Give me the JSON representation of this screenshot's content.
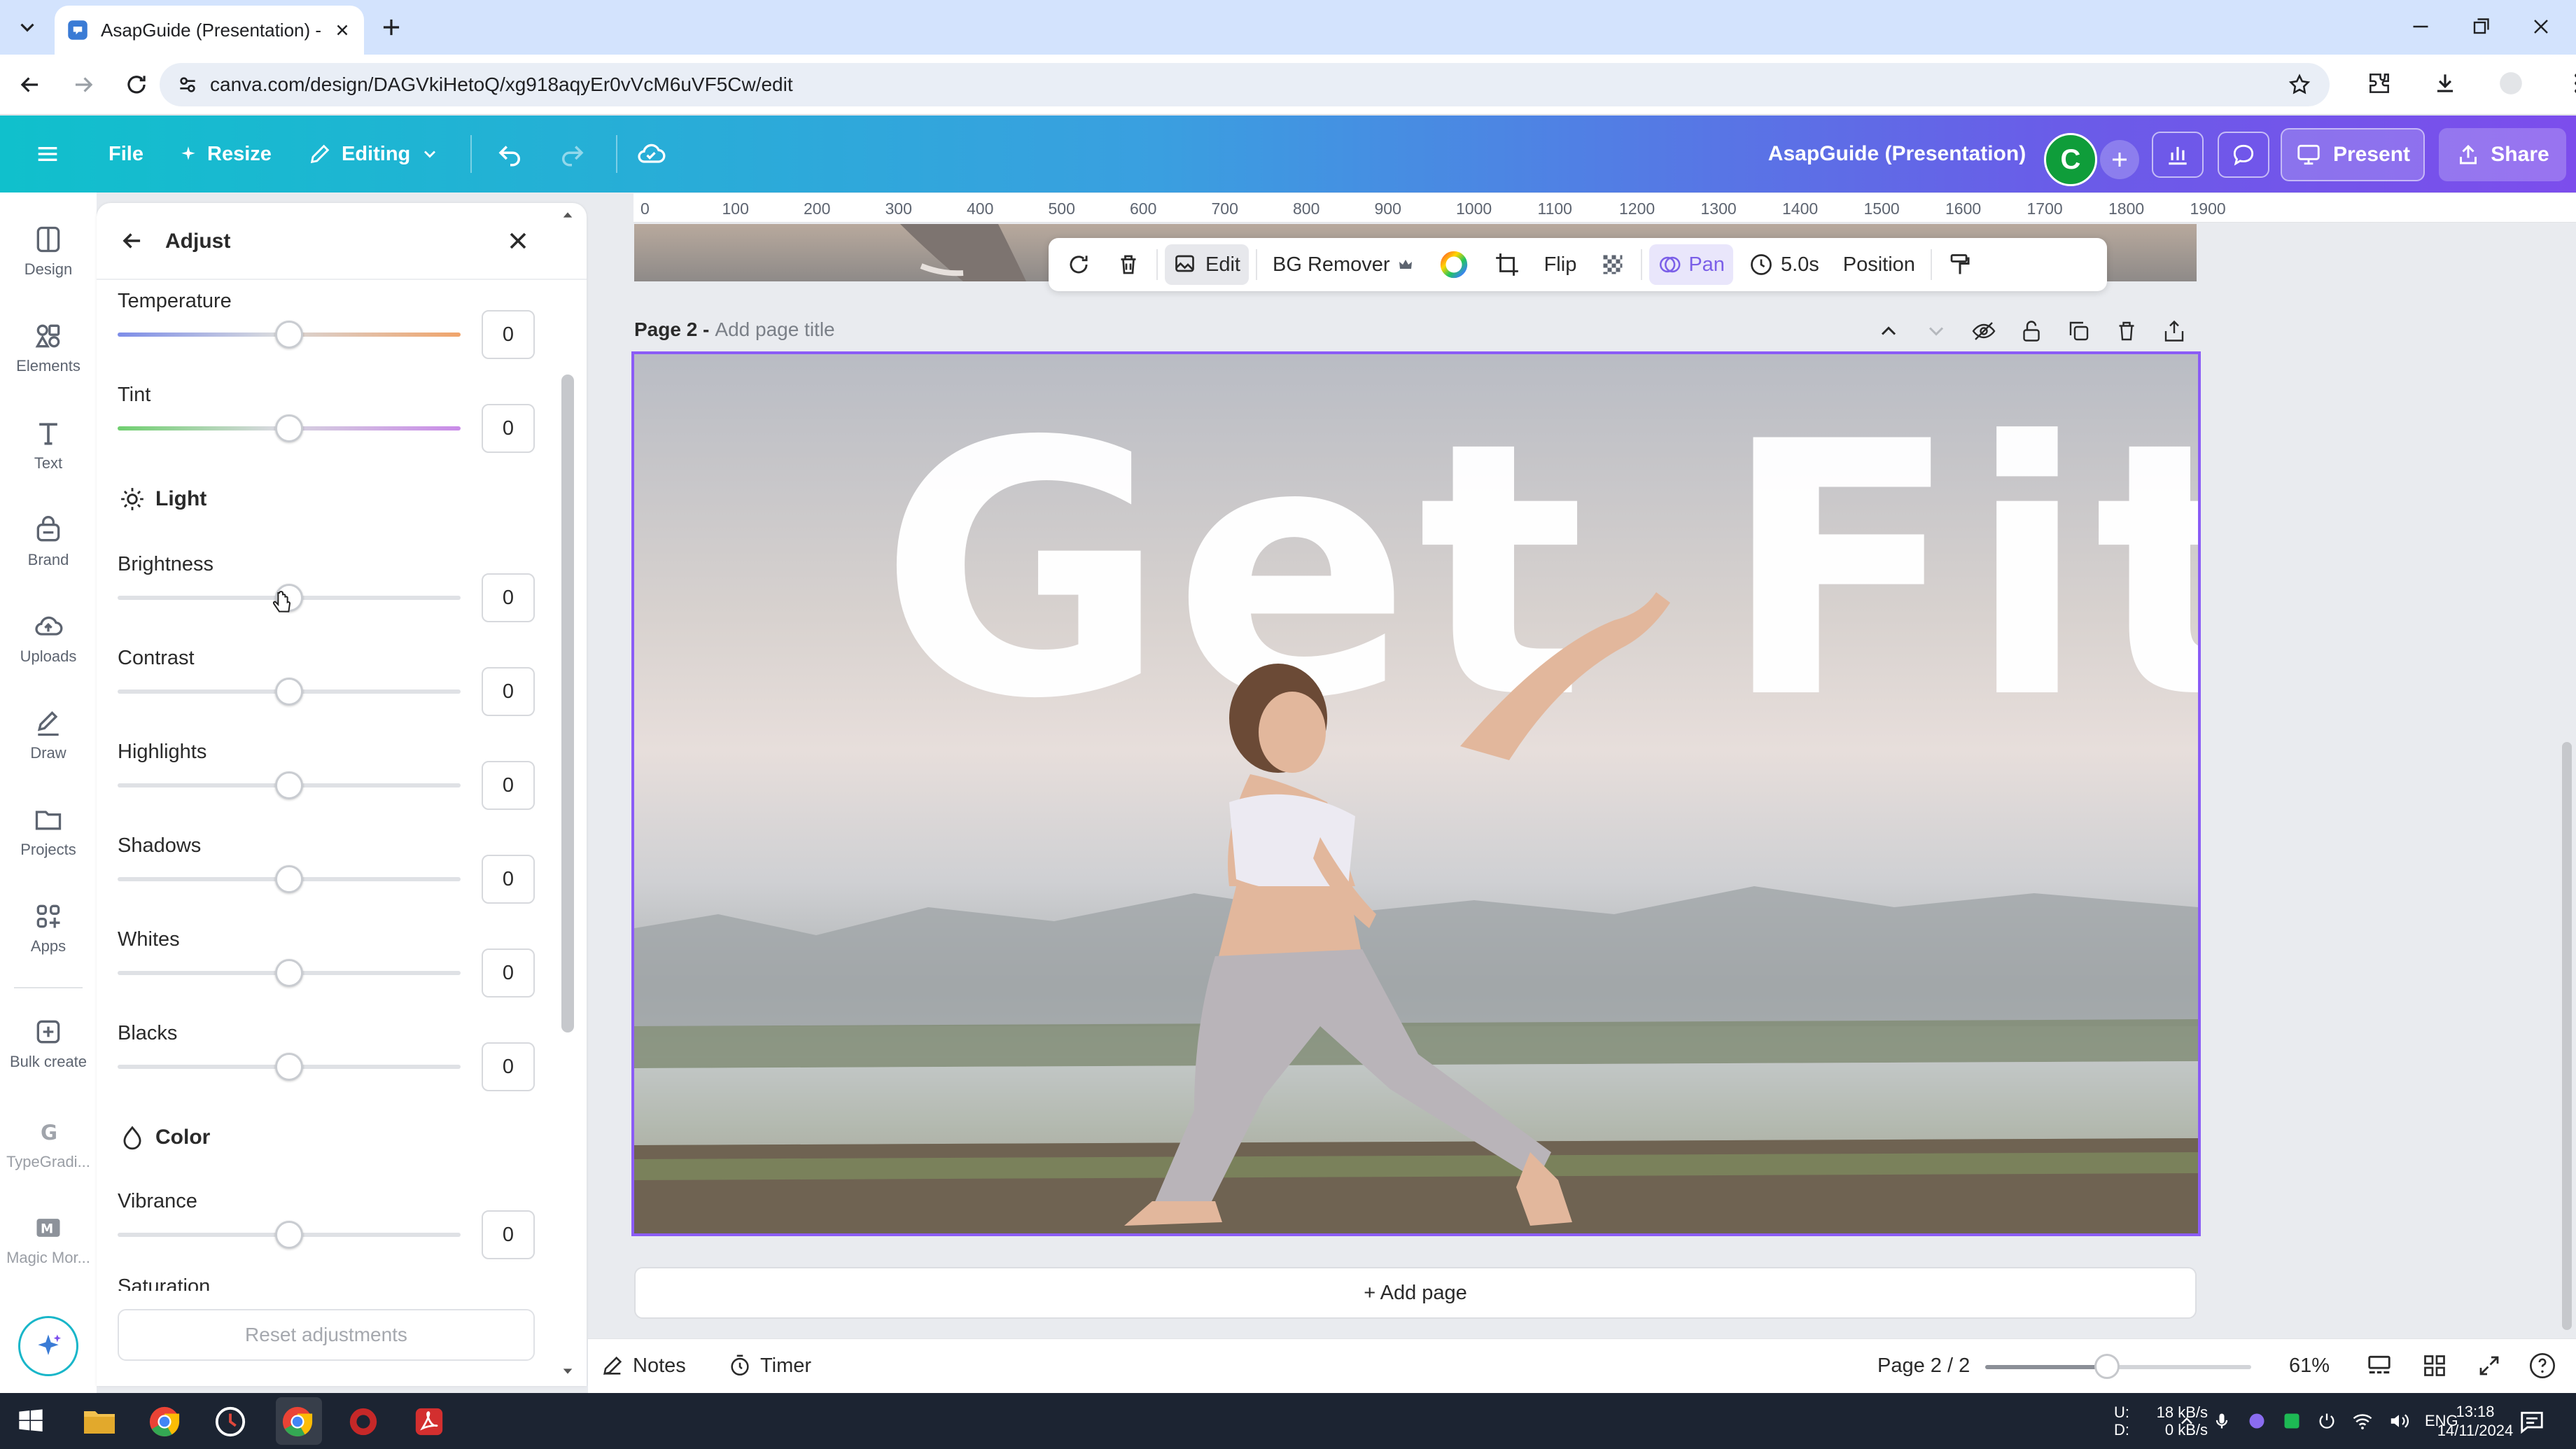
{
  "browser": {
    "tab_title": "AsapGuide (Presentation) - Pre",
    "url": "canva.com/design/DAGVkiHetoQ/xg918aqyEr0vVcM6uVF5Cw/edit"
  },
  "header": {
    "file_label": "File",
    "resize_label": "Resize",
    "editing_label": "Editing",
    "design_title": "AsapGuide (Presentation)",
    "avatar_initial": "C",
    "present_label": "Present",
    "share_label": "Share"
  },
  "rail": [
    {
      "label": "Design",
      "icon": "design-icon"
    },
    {
      "label": "Elements",
      "icon": "elements-icon"
    },
    {
      "label": "Text",
      "icon": "text-icon"
    },
    {
      "label": "Brand",
      "icon": "brand-icon"
    },
    {
      "label": "Uploads",
      "icon": "uploads-icon"
    },
    {
      "label": "Draw",
      "icon": "draw-icon"
    },
    {
      "label": "Projects",
      "icon": "projects-icon"
    },
    {
      "label": "Apps",
      "icon": "apps-icon"
    },
    {
      "label": "Bulk create",
      "icon": "bulk-create-icon"
    },
    {
      "label": "TypeGradi...",
      "icon": "typegradient-icon"
    },
    {
      "label": "Magic Mor...",
      "icon": "magic-morph-icon"
    }
  ],
  "panel": {
    "title": "Adjust",
    "sliders": [
      {
        "label": "Temperature",
        "value": "0"
      },
      {
        "label": "Tint",
        "value": "0"
      },
      {
        "label": "Brightness",
        "value": "0"
      },
      {
        "label": "Contrast",
        "value": "0"
      },
      {
        "label": "Highlights",
        "value": "0"
      },
      {
        "label": "Shadows",
        "value": "0"
      },
      {
        "label": "Whites",
        "value": "0"
      },
      {
        "label": "Blacks",
        "value": "0"
      },
      {
        "label": "Vibrance",
        "value": "0"
      },
      {
        "label": "Saturation",
        "value": ""
      }
    ],
    "section_light": "Light",
    "section_color": "Color",
    "reset_label": "Reset adjustments"
  },
  "ruler": [
    "0",
    "100",
    "200",
    "300",
    "400",
    "500",
    "600",
    "700",
    "800",
    "900",
    "1000",
    "1100",
    "1200",
    "1300",
    "1400",
    "1500",
    "1600",
    "1700",
    "1800",
    "1900"
  ],
  "toolbar": {
    "edit_label": "Edit",
    "bg_remover_label": "BG Remover",
    "flip_label": "Flip",
    "pan_label": "Pan",
    "duration_label": "5.0s",
    "position_label": "Position"
  },
  "page": {
    "page_name": "Page 2 -",
    "title_placeholder": "Add page title",
    "headline": "Get Fit",
    "add_page_label": "+ Add page"
  },
  "footer": {
    "notes_label": "Notes",
    "timer_label": "Timer",
    "page_indicator": "Page 2 / 2",
    "zoom_label": "61%",
    "zoom_percent": 61
  },
  "taskbar": {
    "net_up_label": "U:",
    "net_down_label": "D:",
    "net_up": "18 kB/s",
    "net_down": "0 kB/s",
    "lang": "ENG",
    "time": "13:18",
    "date": "14/11/2024"
  },
  "colors": {
    "accent_purple": "#8b5cf6",
    "header_start": "#10c0cc",
    "header_end": "#7c4dec",
    "avatar_green": "#0f9d3a"
  }
}
